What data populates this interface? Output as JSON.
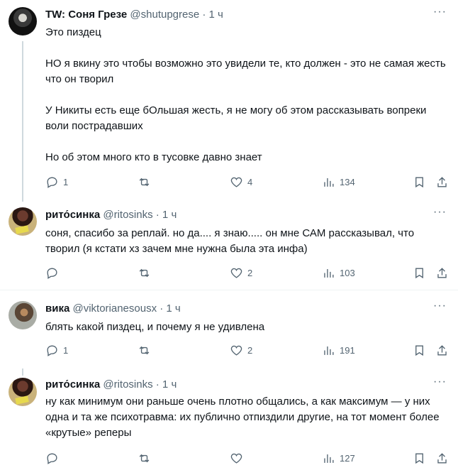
{
  "tweets": [
    {
      "name": "TW: Соня Грезе",
      "handle": "@shutupgrese",
      "time": "· 1 ч",
      "text": "Это пиздец\n\nНО я вкину это чтобы возможно это увидели те, кто должен - это не самая жесть что он творил\n\nУ Никиты есть еще бОльшая жесть, я не могу об этом рассказывать вопреки воли пострадавших\n\nНо об этом много кто в тусовке давно знает",
      "replies": "1",
      "likes": "4",
      "views": "134"
    },
    {
      "name": "рито́синка",
      "handle": "@ritosinks",
      "time": "· 1 ч",
      "text": "соня, спасибо за реплай. но да.... я знаю..... он мне САМ рассказывал, что творил (я кстати хз зачем мне нужна была эта инфа)",
      "replies": "",
      "likes": "2",
      "views": "103"
    },
    {
      "name": "вика",
      "handle": "@viktorianesousx",
      "time": "· 1 ч",
      "text": "блять какой пиздец, и почему я не удивлена",
      "replies": "1",
      "likes": "2",
      "views": "191"
    },
    {
      "name": "рито́синка",
      "handle": "@ritosinks",
      "time": "· 1 ч",
      "text": "ну как минимум они раньше очень плотно общались, а как максимум — у них одна и та же психотравма: их публично отпиздили другие, на тот момент более «крутые» реперы",
      "replies": "",
      "likes": "",
      "views": "127"
    }
  ],
  "icons": [
    "reply-icon",
    "retweet-icon",
    "like-icon",
    "views-icon",
    "bookmark-icon",
    "share-icon",
    "more-icon"
  ]
}
